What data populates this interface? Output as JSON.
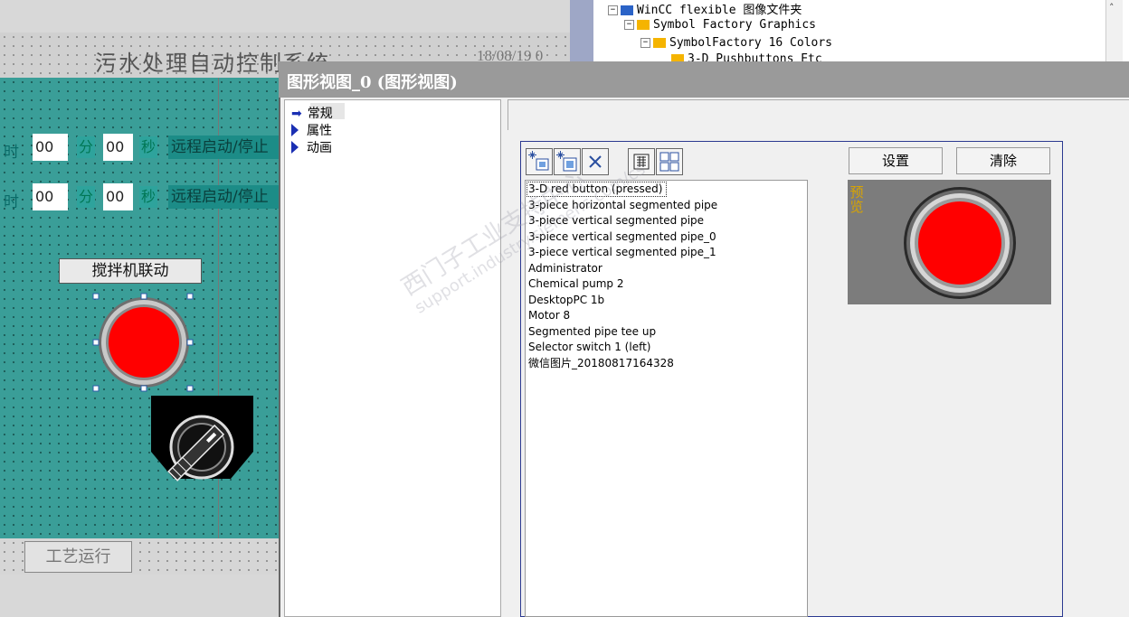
{
  "hmi": {
    "title": "污水处理自动控制系统",
    "datetime": "18/08/19 0",
    "rows": [
      {
        "hour_label": "时",
        "hour_value": "00",
        "min_label": "分",
        "min_value": "00",
        "sec_label": "秒",
        "remote_label": "远程启动/停止"
      },
      {
        "hour_label": "时",
        "hour_value": "00",
        "min_label": "分",
        "min_value": "00",
        "sec_label": "秒",
        "remote_label": "远程启动/停止"
      }
    ],
    "mixer_button": "搅拌机联动",
    "process_button": "工艺运行"
  },
  "tree": {
    "items": [
      {
        "label": "WinCC flexible 图像文件夹",
        "expander": "−"
      },
      {
        "label": "Symbol Factory Graphics",
        "expander": "−"
      },
      {
        "label": "SymbolFactory 16 Colors",
        "expander": "−"
      },
      {
        "label": "3-D Pushbuttons Etc",
        "expander": ""
      }
    ]
  },
  "dialog": {
    "title": "图形视图_0 (图形视图)",
    "nav": [
      "常规",
      "属性",
      "动画"
    ],
    "graphics_list": [
      "3-D red button (pressed)",
      "3-piece horizontal segmented pipe",
      "3-piece vertical segmented pipe",
      "3-piece vertical segmented pipe_0",
      "3-piece vertical segmented pipe_1",
      "Administrator",
      "Chemical pump 2",
      "DesktopPC 1b",
      "Motor 8",
      "Segmented pipe tee up",
      "Selector switch 1 (left)",
      "微信图片_20180817164328"
    ],
    "set_button": "设置",
    "clear_button": "清除",
    "preview_label": "预览"
  },
  "watermark": {
    "line1": "西门子工业支持中心",
    "line2": "support.industry.siemens.com/cs"
  },
  "colors": {
    "button_red": "#ff0000",
    "hmi_teal": "#3a9e98",
    "dialog_title_bg": "#9a9a9a"
  }
}
